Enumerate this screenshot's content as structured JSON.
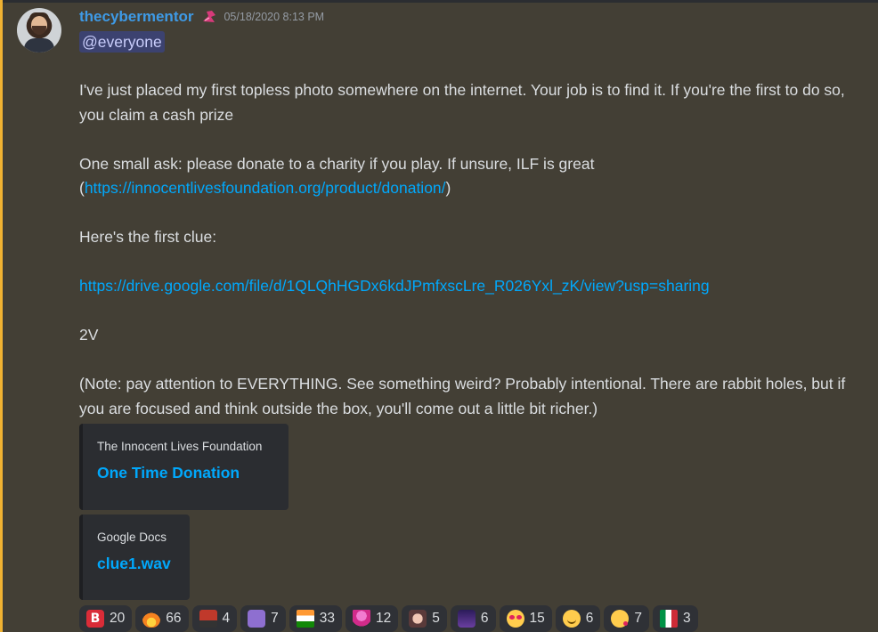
{
  "message": {
    "username": "thecybermentor",
    "timestamp": "05/18/2020 8:13 PM",
    "mention": "@everyone",
    "paragraphs": {
      "p1": "I've just placed my first topless photo somewhere on the internet. Your job is to find it. If you're the first to do so, you claim a cash prize",
      "p2_text": "One small ask: please donate to a charity if you play. If unsure, ILF is great",
      "p2_open": "(",
      "p2_link": "https://innocentlivesfoundation.org/product/donation/",
      "p2_close": ")",
      "p3": "Here's the first clue:",
      "p4_link": "https://drive.google.com/file/d/1QLQhHGDx6kdJPmfxscLre_R026Yxl_zK/view?usp=sharing",
      "p5": "2V",
      "p6": "(Note: pay attention to EVERYTHING.  See something weird? Probably intentional.  There are rabbit holes, but if you are focused and think outside the box, you'll come out a little bit richer.)"
    }
  },
  "embeds": [
    {
      "provider": "The Innocent Lives Foundation",
      "title": "One Time Donation"
    },
    {
      "provider": "Google Docs",
      "title": "clue1.wav"
    }
  ],
  "reactions": [
    {
      "icon": "letter-b-emoji",
      "glyph": "B",
      "count": "20"
    },
    {
      "icon": "fire-emoji",
      "glyph": "",
      "count": "66"
    },
    {
      "icon": "fire-truck-emoji",
      "glyph": "",
      "count": "4"
    },
    {
      "icon": "purple-custom-emoji",
      "glyph": "",
      "count": "7"
    },
    {
      "icon": "india-flag-emoji",
      "glyph": "",
      "count": "33"
    },
    {
      "icon": "pink-character-emoji",
      "glyph": "",
      "count": "12"
    },
    {
      "icon": "anime-face-emoji",
      "glyph": "",
      "count": "5"
    },
    {
      "icon": "night-city-emoji",
      "glyph": "",
      "count": "6"
    },
    {
      "icon": "heart-eyes-emoji",
      "glyph": "",
      "count": "15"
    },
    {
      "icon": "smiling-face-with-hearts-emoji",
      "glyph": "",
      "count": "6"
    },
    {
      "icon": "face-blowing-kiss-emoji",
      "glyph": "",
      "count": "7"
    },
    {
      "icon": "italy-flag-emoji",
      "glyph": "",
      "count": "3"
    }
  ],
  "colors": {
    "background": "#433f35",
    "mention_bar": "#f0b232",
    "username": "#3e9ae6",
    "link": "#00a8fc",
    "mention_bg": "#3c4270"
  }
}
